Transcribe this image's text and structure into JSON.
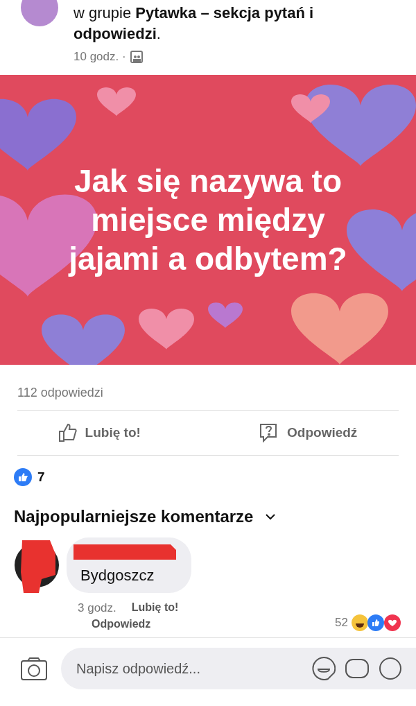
{
  "post_header": {
    "group_line": "w grupie **Pytawka – sekcja pytań i odpowiedzi**.",
    "time": "10 godz. ·"
  },
  "post_card": {
    "kind": "picture",
    "question": "Jak się nazywa to miejsce między jajami a odbytem?"
  },
  "answers_count": "112 odpowiedzi",
  "actions": [
    {
      "kind": "like",
      "label": "Lubię to!"
    },
    {
      "kind": "answer",
      "label": "Odpowiedź"
    }
  ],
  "reactions": {
    "count": "7"
  },
  "comments_heading": "Najpopularniejsze komentarze",
  "comment": {
    "text": "Bydgoszcz",
    "time": "3 godz.",
    "like": "Lubię to!",
    "reply": "Odpowiedz",
    "reaction_count": "52"
  },
  "composer": {
    "placeholder": "Napisz odpowiedź..."
  }
}
